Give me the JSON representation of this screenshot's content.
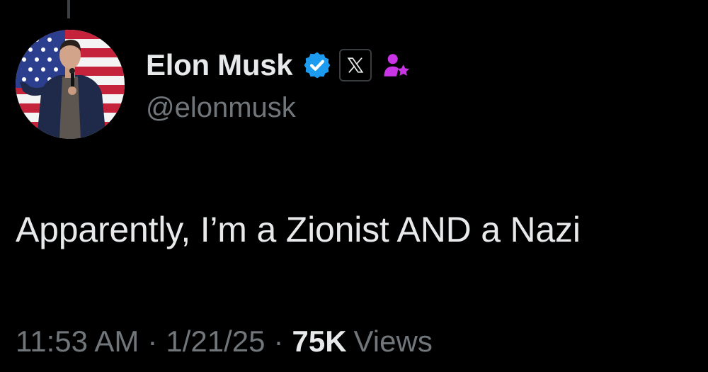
{
  "post": {
    "author": {
      "display_name": "Elon Musk",
      "handle": "@elonmusk",
      "avatar": "portrait-on-american-flag",
      "badges": [
        "verified-badge-icon",
        "x-logo-icon",
        "role-person-star-icon"
      ],
      "verified_color": "#1d9bf0",
      "role_icon_color": "#c935e6"
    },
    "text": "Apparently, I’m a Zionist AND a Nazi",
    "meta": {
      "time": "11:53 AM",
      "separator": "·",
      "date": "1/21/25",
      "views_count": "75K",
      "views_label": "Views"
    }
  }
}
